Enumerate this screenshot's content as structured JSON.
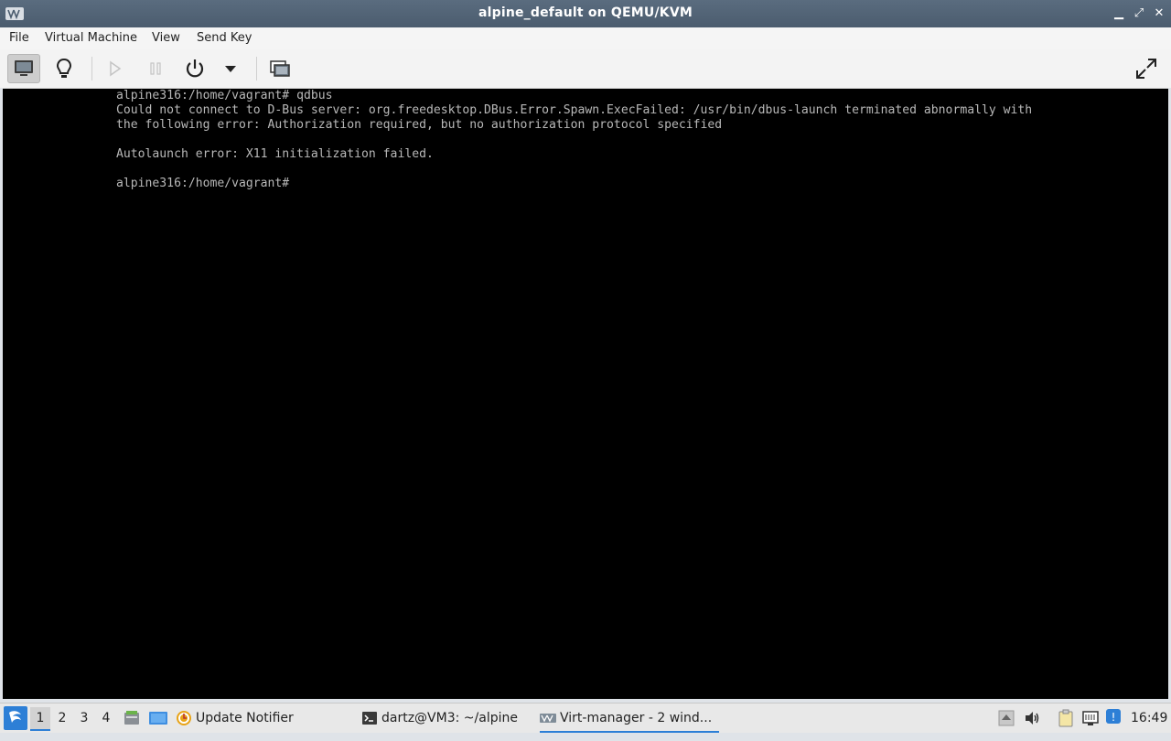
{
  "window": {
    "title": "alpine_default on QEMU/KVM",
    "minimize_glyph": "▁",
    "maximize_glyph": "⤢",
    "close_glyph": "✕"
  },
  "menu": [
    "File",
    "Virtual Machine",
    "View",
    "Send Key"
  ],
  "toolbar": {
    "buttons": [
      "console-icon",
      "lightbulb-icon",
      "play-icon",
      "pause-icon",
      "power-icon",
      "dropdown-arrow-icon",
      "snapshots-icon",
      "fullscreen-icon"
    ]
  },
  "console": {
    "lines": [
      "alpine316:/home/vagrant# qdbus",
      "Could not connect to D-Bus server: org.freedesktop.DBus.Error.Spawn.ExecFailed: /usr/bin/dbus-launch terminated abnormally with",
      "the following error: Authorization required, but no authorization protocol specified",
      "",
      "Autolaunch error: X11 initialization failed.",
      "",
      "alpine316:/home/vagrant#"
    ]
  },
  "taskbar": {
    "workspaces": [
      "1",
      "2",
      "3",
      "4"
    ],
    "active_workspace": "1",
    "tasks": [
      {
        "label": "Update Notifier",
        "icon": "update-notifier-icon"
      },
      {
        "label": "dartz@VM3: ~/alpine",
        "icon": "terminal-icon"
      },
      {
        "label": "Virt-manager - 2 wind...",
        "icon": "virt-manager-icon"
      }
    ],
    "clock": "16:49"
  },
  "colors": {
    "titlebar": "#4f6073",
    "console_bg": "#000000",
    "console_text": "#b8b8b8",
    "accent": "#2d7fd6"
  }
}
